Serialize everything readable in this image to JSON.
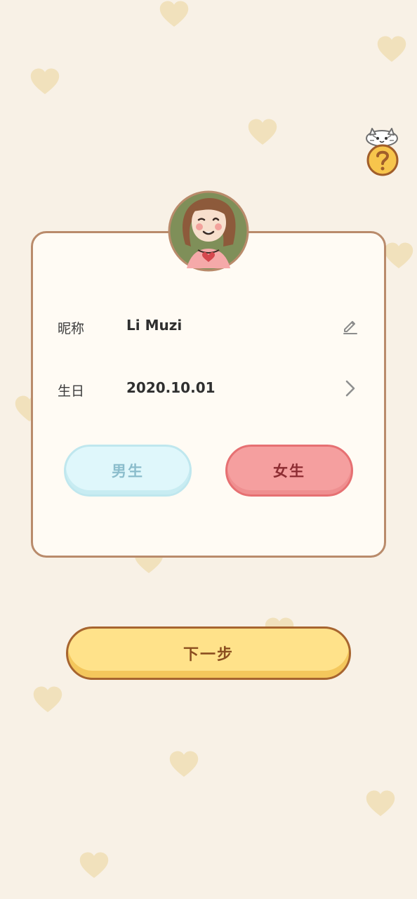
{
  "profile": {
    "nickname_label": "昵称",
    "nickname_value": "Li Muzi",
    "birthday_label": "生日",
    "birthday_value": "2020.10.01"
  },
  "gender": {
    "male_label": "男生",
    "female_label": "女生",
    "selected": "female"
  },
  "actions": {
    "next_label": "下一步"
  },
  "icons": {
    "help": "question-mark-icon",
    "edit": "pencil-icon",
    "birthday_action": "chevron-right-icon",
    "avatar": "girl-avatar"
  },
  "colors": {
    "background": "#f8f1e6",
    "card_border": "#b98b6b",
    "female_button": "#f59f9f",
    "male_button": "#dff7fb",
    "next_button": "#ffe28a",
    "heart_decor": "#f1e0b8"
  }
}
